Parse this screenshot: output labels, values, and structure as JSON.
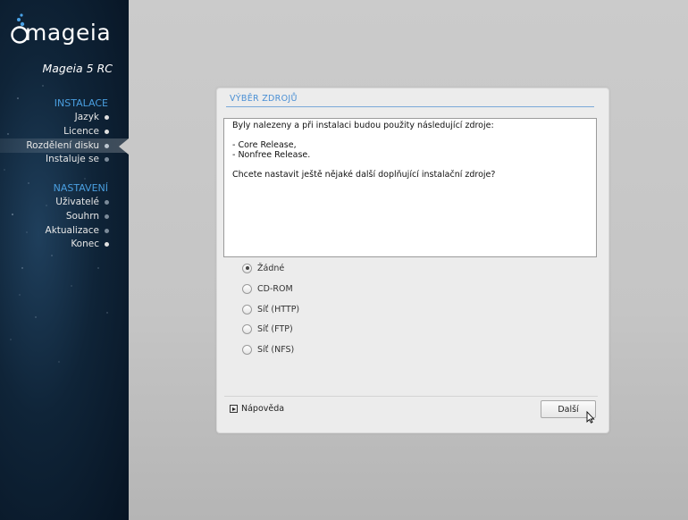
{
  "sidebar": {
    "logo_text": "mageia",
    "version": "Mageia 5 RC",
    "sections": [
      {
        "title": "INSTALACE",
        "items": [
          {
            "label": "Jazyk",
            "state": "done"
          },
          {
            "label": "Licence",
            "state": "done"
          },
          {
            "label": "Rozdělení disku",
            "state": "active"
          },
          {
            "label": "Instaluje se",
            "state": "pending"
          }
        ]
      },
      {
        "title": "NASTAVENÍ",
        "items": [
          {
            "label": "Uživatelé",
            "state": "pending"
          },
          {
            "label": "Souhrn",
            "state": "pending"
          },
          {
            "label": "Aktualizace",
            "state": "pending"
          },
          {
            "label": "Konec",
            "state": "done"
          }
        ]
      }
    ]
  },
  "dialog": {
    "title": "VÝBĚR ZDROJŮ",
    "message": {
      "line1": "Byly nalezeny a při instalaci budou použity následující zdroje:",
      "line2": "- Core Release,",
      "line3": "- Nonfree Release.",
      "line4": "Chcete nastavit ještě nějaké další doplňující instalační zdroje?"
    },
    "options": [
      {
        "label": "Žádné",
        "selected": true
      },
      {
        "label": "CD-ROM",
        "selected": false
      },
      {
        "label": "Síť (HTTP)",
        "selected": false
      },
      {
        "label": "Síť (FTP)",
        "selected": false
      },
      {
        "label": "Síť (NFS)",
        "selected": false
      }
    ],
    "help_label": "Nápověda",
    "next_label": "Další"
  },
  "colors": {
    "accent": "#4a9fe0",
    "sidebar_bg": "#0f2438",
    "dialog_bg": "#ececec"
  }
}
